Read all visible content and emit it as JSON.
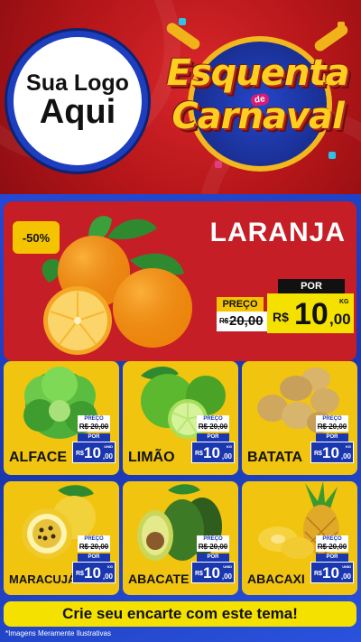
{
  "header": {
    "logo_line1": "Sua Logo",
    "logo_line2": "Aqui",
    "title_line1": "Esquenta",
    "title_connector": "de",
    "title_line2": "Carnaval"
  },
  "hero": {
    "discount": "-50%",
    "name": "LARANJA",
    "preco_label": "PREÇO",
    "old_currency": "R$",
    "old_price": "20,00",
    "por_label": "POR",
    "currency": "R$",
    "price_int": "10",
    "price_cents": ",00",
    "unit": "KG"
  },
  "products": [
    {
      "name": "ALFACE",
      "preco_label": "PREÇO",
      "old_price": "R$ 20,00",
      "por_label": "POR",
      "currency": "R$",
      "price_int": "10",
      "price_cents": ",00",
      "unit": "UNID"
    },
    {
      "name": "LIMÃO",
      "preco_label": "PREÇO",
      "old_price": "R$ 20,00",
      "por_label": "POR",
      "currency": "R$",
      "price_int": "10",
      "price_cents": ",00",
      "unit": "KG"
    },
    {
      "name": "BATATA",
      "preco_label": "PREÇO",
      "old_price": "R$ 20,00",
      "por_label": "POR",
      "currency": "R$",
      "price_int": "10",
      "price_cents": ",00",
      "unit": "KG"
    },
    {
      "name": "MARACUJÁ",
      "preco_label": "PREÇO",
      "old_price": "R$ 20,00",
      "por_label": "POR",
      "currency": "R$",
      "price_int": "10",
      "price_cents": ",00",
      "unit": "KG"
    },
    {
      "name": "ABACATE",
      "preco_label": "PREÇO",
      "old_price": "R$ 20,00",
      "por_label": "POR",
      "currency": "R$",
      "price_int": "10",
      "price_cents": ",00",
      "unit": "UNID"
    },
    {
      "name": "ABACAXI",
      "preco_label": "PREÇO",
      "old_price": "R$ 20,00",
      "por_label": "POR",
      "currency": "R$",
      "price_int": "10",
      "price_cents": ",00",
      "unit": "UNID"
    }
  ],
  "footer": {
    "cta": "Crie seu encarte com este tema!",
    "disclaimer": "*Imagens Meramente Ilustrativas"
  },
  "colors": {
    "header_red": "#c61e26",
    "main_blue": "#1b37b0",
    "card_yellow": "#f1c40f",
    "price_yellow": "#f5e100"
  }
}
